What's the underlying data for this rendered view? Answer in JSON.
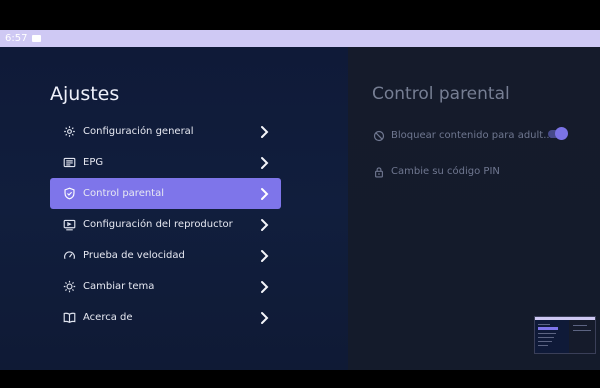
{
  "status": {
    "time": "6:57"
  },
  "left": {
    "title": "Ajustes",
    "items": [
      {
        "label": "Configuración general",
        "icon": "settings-gear-icon"
      },
      {
        "label": "EPG",
        "icon": "epg-guide-icon"
      },
      {
        "label": "Control parental",
        "icon": "shield-check-icon",
        "active": true
      },
      {
        "label": "Configuración del reproductor",
        "icon": "player-settings-icon"
      },
      {
        "label": "Prueba de velocidad",
        "icon": "speedometer-icon"
      },
      {
        "label": "Cambiar tema",
        "icon": "sun-theme-icon"
      },
      {
        "label": "Acerca de",
        "icon": "book-open-icon"
      }
    ]
  },
  "right": {
    "title": "Control parental",
    "block_label": "Bloquear contenido para adult...",
    "block_enabled": true,
    "pin_label": "Cambie su código PIN"
  },
  "colors": {
    "accent": "#7e75ea",
    "status_bar": "#cfc9f4",
    "left_bg": "#0f1a38",
    "right_bg": "#151b2b"
  }
}
